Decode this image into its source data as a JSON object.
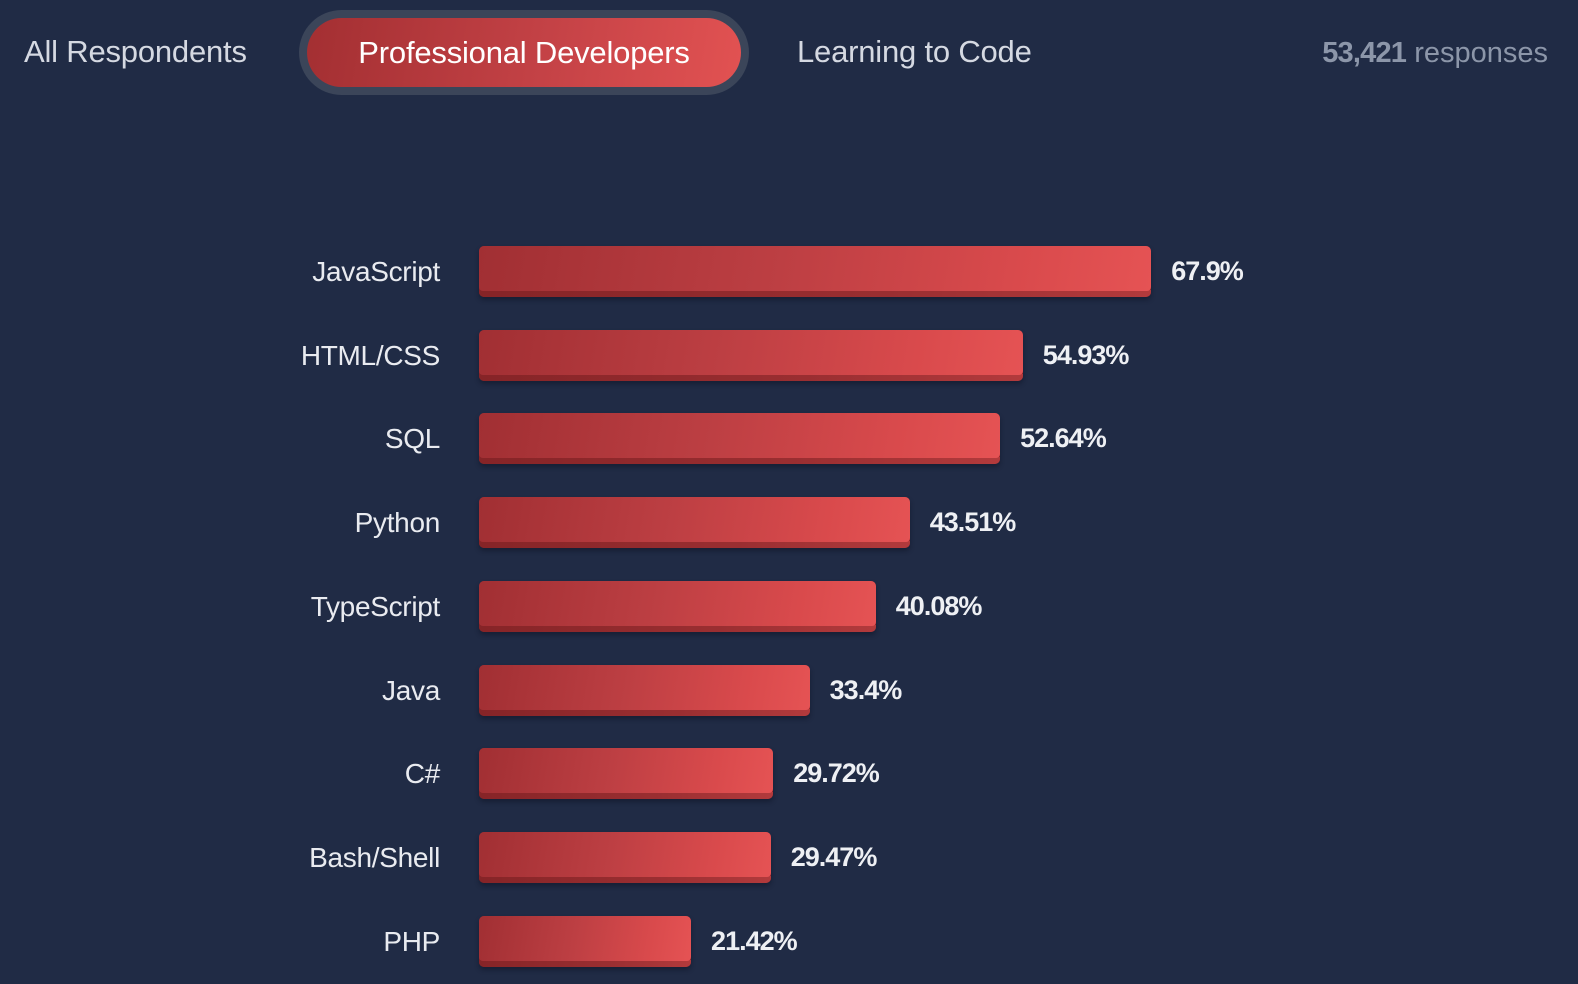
{
  "tabs": [
    {
      "label": "All Respondents",
      "selected": false
    },
    {
      "label": "Professional Developers",
      "selected": true
    },
    {
      "label": "Learning to Code",
      "selected": false
    }
  ],
  "responses": {
    "count": "53,421",
    "suffix": "responses"
  },
  "colors": {
    "background": "#202b45",
    "bar_start": "#a12f33",
    "bar_end": "#e55354",
    "tab_active": "#c44246",
    "text": "#e9ebf0",
    "muted": "#8c96a9"
  },
  "chart_data": {
    "type": "bar",
    "orientation": "horizontal",
    "title": "",
    "xlabel": "",
    "ylabel": "",
    "unit": "%",
    "xlim": [
      0,
      100
    ],
    "grid": false,
    "categories": [
      "JavaScript",
      "HTML/CSS",
      "SQL",
      "Python",
      "TypeScript",
      "Java",
      "C#",
      "Bash/Shell",
      "PHP"
    ],
    "values": [
      67.9,
      54.93,
      52.64,
      43.51,
      40.08,
      33.4,
      29.72,
      29.47,
      21.42
    ],
    "value_labels": [
      "67.9%",
      "54.93%",
      "52.64%",
      "43.51%",
      "40.08%",
      "33.4%",
      "29.72%",
      "29.47%",
      "21.42%"
    ]
  }
}
